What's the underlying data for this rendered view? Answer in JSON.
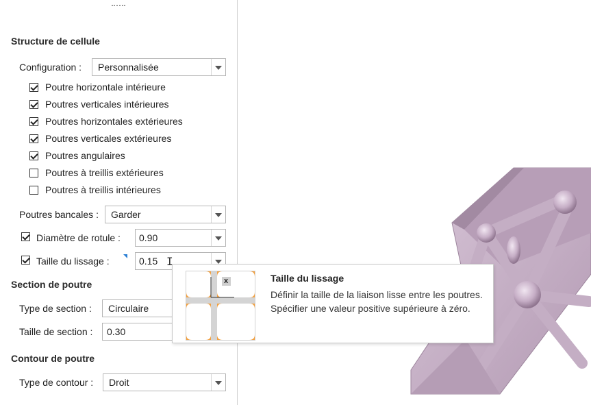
{
  "sections": {
    "cell_structure": "Structure de cellule",
    "beam_section": "Section de poutre",
    "beam_contour": "Contour de poutre"
  },
  "configuration": {
    "label": "Configuration :",
    "value": "Personnalisée"
  },
  "beams": [
    {
      "label": "Poutre horizontale intérieure",
      "checked": true
    },
    {
      "label": "Poutres verticales intérieures",
      "checked": true
    },
    {
      "label": "Poutres horizontales extérieures",
      "checked": true
    },
    {
      "label": "Poutres verticales extérieures",
      "checked": true
    },
    {
      "label": "Poutres angulaires",
      "checked": true
    },
    {
      "label": "Poutres à treillis extérieures",
      "checked": false
    },
    {
      "label": "Poutres à treillis intérieures",
      "checked": false
    }
  ],
  "bent_beams": {
    "label": "Poutres bancales :",
    "value": "Garder"
  },
  "joint_diameter": {
    "label": "Diamètre de rotule :",
    "value": "0.90",
    "checked": true
  },
  "smoothing_size": {
    "label": "Taille du lissage :",
    "value": "0.15",
    "checked": true
  },
  "section_type": {
    "label": "Type de section :",
    "value": "Circulaire"
  },
  "section_size": {
    "label": "Taille de section :",
    "value": "0.30"
  },
  "contour_type": {
    "label": "Type de contour :",
    "value": "Droit"
  },
  "tooltip": {
    "title": "Taille du lissage",
    "description": "Définir la taille de la liaison lisse entre les poutres. Spécifier une valeur positive supérieure à zéro.",
    "illustration_label": "x"
  },
  "colors": {
    "accent": "#2a7fd4",
    "model": "#c9b4c9",
    "illustration": "#f2a040"
  }
}
